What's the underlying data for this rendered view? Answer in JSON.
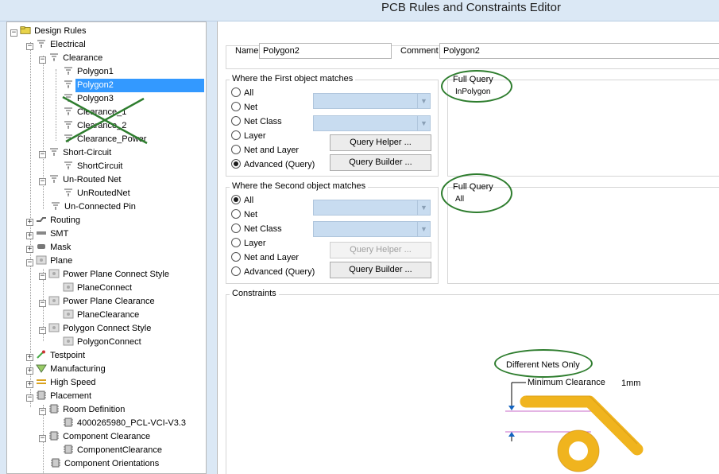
{
  "window": {
    "title": "PCB Rules and Constraints Editor"
  },
  "tree": {
    "items": [
      {
        "label": "Design Rules",
        "icon": "design-rules-icon"
      },
      {
        "label": "Electrical",
        "icon": "rule-icon"
      },
      {
        "label": "Clearance",
        "icon": "rule-icon"
      },
      {
        "label": "Polygon1",
        "icon": "rule-icon"
      },
      {
        "label": "Polygon2",
        "icon": "rule-icon",
        "selected": true
      },
      {
        "label": "Polygon3",
        "icon": "rule-icon"
      },
      {
        "label": "Clearance_1",
        "icon": "rule-icon"
      },
      {
        "label": "Clearance_2",
        "icon": "rule-icon"
      },
      {
        "label": "Clearance_Power",
        "icon": "rule-icon"
      },
      {
        "label": "Short-Circuit",
        "icon": "rule-icon"
      },
      {
        "label": "ShortCircuit",
        "icon": "rule-icon"
      },
      {
        "label": "Un-Routed Net",
        "icon": "rule-icon"
      },
      {
        "label": "UnRoutedNet",
        "icon": "rule-icon"
      },
      {
        "label": "Un-Connected Pin",
        "icon": "rule-icon"
      },
      {
        "label": "Routing",
        "icon": "routing-icon"
      },
      {
        "label": "SMT",
        "icon": "smt-icon"
      },
      {
        "label": "Mask",
        "icon": "mask-icon"
      },
      {
        "label": "Plane",
        "icon": "plane-icon"
      },
      {
        "label": "Power Plane Connect Style",
        "icon": "plane-icon"
      },
      {
        "label": "PlaneConnect",
        "icon": "plane-icon"
      },
      {
        "label": "Power Plane Clearance",
        "icon": "plane-icon"
      },
      {
        "label": "PlaneClearance",
        "icon": "plane-icon"
      },
      {
        "label": "Polygon Connect Style",
        "icon": "plane-icon"
      },
      {
        "label": "PolygonConnect",
        "icon": "plane-icon"
      },
      {
        "label": "Testpoint",
        "icon": "testpoint-icon"
      },
      {
        "label": "Manufacturing",
        "icon": "manufacturing-icon"
      },
      {
        "label": "High Speed",
        "icon": "highspeed-icon"
      },
      {
        "label": "Placement",
        "icon": "placement-icon"
      },
      {
        "label": "Room Definition",
        "icon": "placement-icon"
      },
      {
        "label": "4000265980_PCL-VCI-V3.3",
        "icon": "placement-icon"
      },
      {
        "label": "Component Clearance",
        "icon": "placement-icon"
      },
      {
        "label": "ComponentClearance",
        "icon": "placement-icon"
      },
      {
        "label": "Component Orientations",
        "icon": "placement-icon"
      }
    ]
  },
  "rule": {
    "name_label": "Name",
    "name_value": "Polygon2",
    "comment_label": "Comment",
    "comment_value": "Polygon2"
  },
  "first_match": {
    "title": "Where the First object matches",
    "options": [
      "All",
      "Net",
      "Net Class",
      "Layer",
      "Net and Layer",
      "Advanced (Query)"
    ],
    "selected": "Advanced (Query)",
    "query_helper": "Query Helper ...",
    "query_builder": "Query Builder ...",
    "full_query_label": "Full Query",
    "full_query": "InPolygon"
  },
  "second_match": {
    "title": "Where the Second object matches",
    "options": [
      "All",
      "Net",
      "Net Class",
      "Layer",
      "Net and Layer",
      "Advanced (Query)"
    ],
    "selected": "All",
    "query_helper": "Query Helper ...",
    "query_builder": "Query Builder ...",
    "full_query_label": "Full Query",
    "full_query": "All"
  },
  "constraints": {
    "title": "Constraints",
    "net_scope": "Different Nets Only",
    "min_clearance_label": "Minimum Clearance",
    "min_clearance_value": "1mm"
  },
  "colors": {
    "selection": "#3399ff",
    "annotation": "#2e7d2e",
    "track": "#f0b41e",
    "window_frame": "#dbe8f5"
  }
}
